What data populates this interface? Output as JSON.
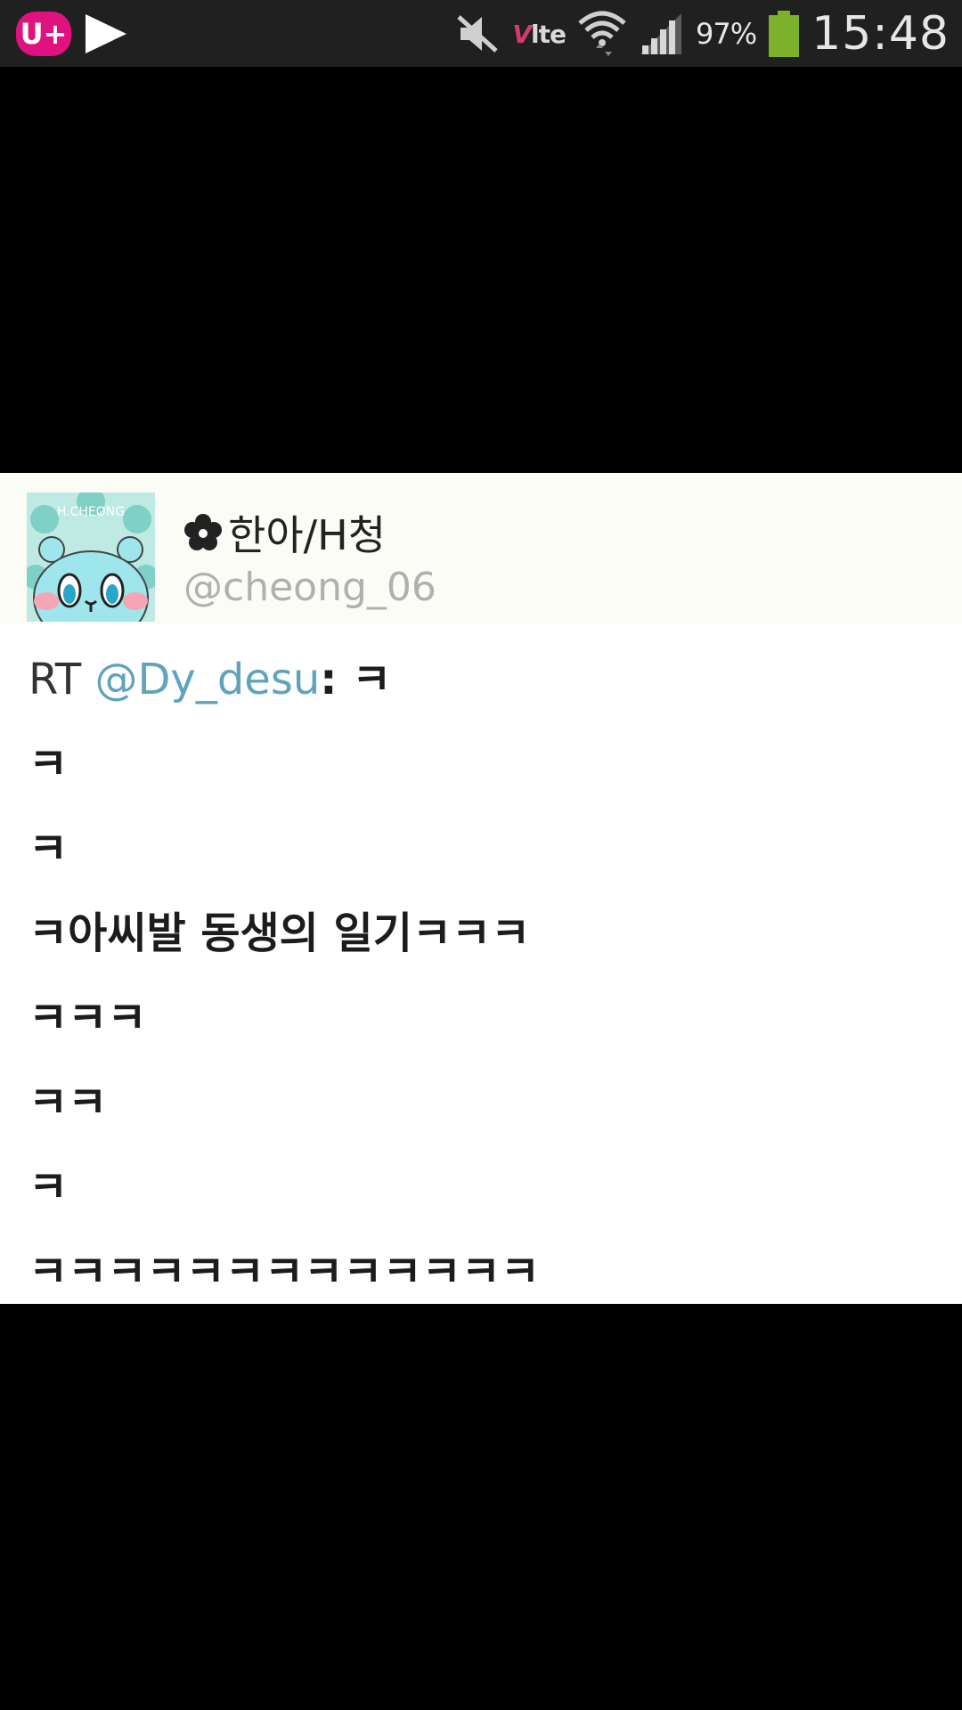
{
  "status_bar": {
    "carrier_logo": "U+",
    "icons": [
      "uplus-logo-icon",
      "play-icon",
      "mute-icon",
      "volte-icon",
      "wifi-icon",
      "signal-icon",
      "battery-icon"
    ],
    "volte_prefix": "V",
    "volte_text": "lte",
    "battery_percent": "97%",
    "battery_level": 0.97,
    "time": "15:48",
    "colors": {
      "background": "#202020",
      "uplus": "#e0127f",
      "battery": "#7db12c",
      "volte_accent": "#d23c6c"
    }
  },
  "tweet": {
    "display_name": "한아/H청",
    "handle": "@cheong_06",
    "avatar_caption": "H.CHEONG",
    "rt_label": "RT",
    "mention": "@Dy_desu",
    "first_line_rest": ": ㅋ",
    "lines": [
      "ㅋ",
      "ㅋ",
      "ㅋ아씨발 동생의 일기ㅋㅋㅋ",
      "ㅋㅋㅋ",
      "ㅋㅋ",
      "ㅋ",
      "ㅋㅋㅋㅋㅋㅋㅋㅋㅋㅋㅋㅋㅋ"
    ],
    "colors": {
      "mention": "#5fa3bd",
      "handle": "#b0b0b0",
      "text": "#1c1c1c"
    }
  }
}
